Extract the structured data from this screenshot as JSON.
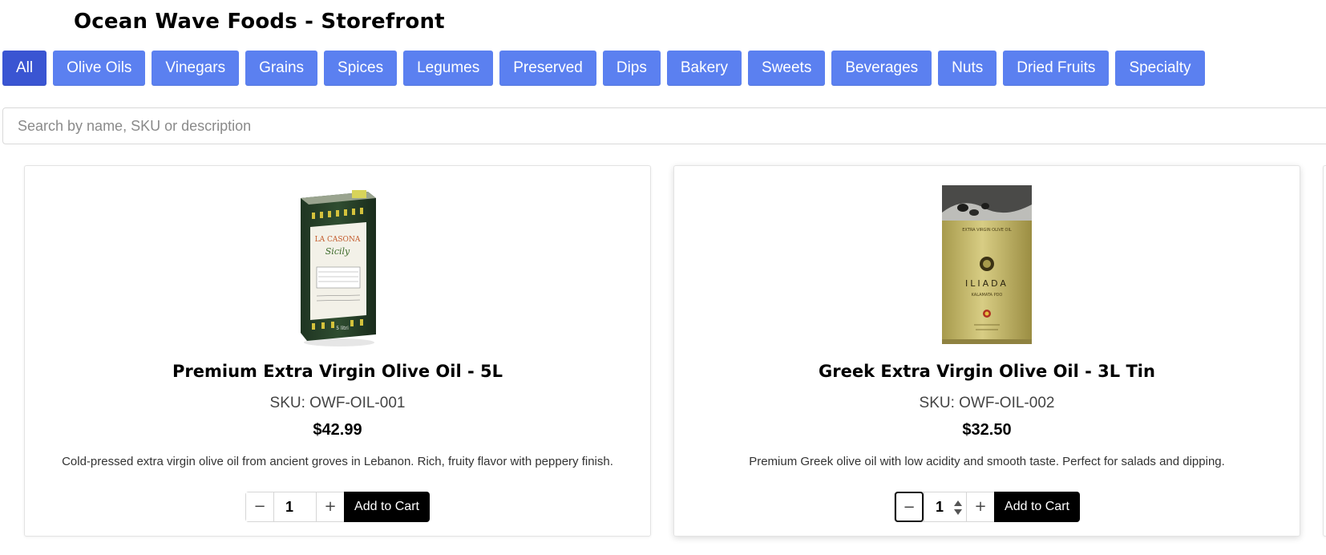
{
  "header": {
    "title": "Ocean Wave Foods - Storefront"
  },
  "categories": [
    {
      "label": "All",
      "active": true
    },
    {
      "label": "Olive Oils"
    },
    {
      "label": "Vinegars"
    },
    {
      "label": "Grains"
    },
    {
      "label": "Spices"
    },
    {
      "label": "Legumes"
    },
    {
      "label": "Preserved"
    },
    {
      "label": "Dips"
    },
    {
      "label": "Bakery"
    },
    {
      "label": "Sweets"
    },
    {
      "label": "Beverages"
    },
    {
      "label": "Nuts"
    },
    {
      "label": "Dried Fruits"
    },
    {
      "label": "Specialty"
    }
  ],
  "search": {
    "placeholder": "Search by name, SKU or description",
    "value": ""
  },
  "products": [
    {
      "name": "Premium Extra Virgin Olive Oil - 5L",
      "sku": "SKU: OWF-OIL-001",
      "price": "$42.99",
      "description": "Cold-pressed extra virgin olive oil from ancient groves in Lebanon. Rich, fruity flavor with peppery finish.",
      "quantity": "1",
      "image": {
        "brand": "LA CASONA",
        "script": "Sicily",
        "volume": "5 litri"
      }
    },
    {
      "name": "Greek Extra Virgin Olive Oil - 3L Tin",
      "sku": "SKU: OWF-OIL-002",
      "price": "$32.50",
      "description": "Premium Greek olive oil with low acidity and smooth taste. Perfect for salads and dipping.",
      "quantity": "1",
      "image": {
        "top": "EXTRA VIRGIN OLIVE OIL",
        "brand": "ILIADA",
        "sub": "KALAMATA PDO"
      }
    }
  ],
  "cart": {
    "minus": "−",
    "plus": "+",
    "add_label": "Add to Cart"
  },
  "colors": {
    "tab": "#5b80f0",
    "tab_active": "#3a55d2",
    "add_button": "#000000"
  }
}
